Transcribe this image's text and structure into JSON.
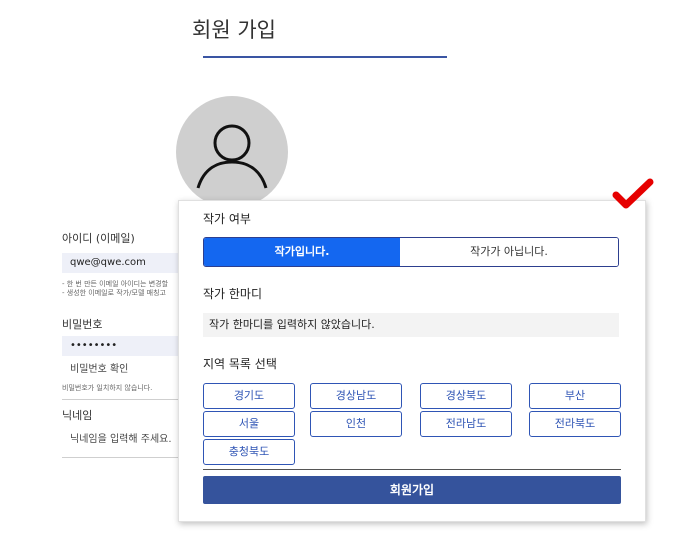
{
  "header": {
    "title": "회원 가입"
  },
  "form": {
    "id_label": "아이디 (이메일)",
    "id_value": "qwe@qwe.com",
    "id_hint_1": "- 한 번 만든 이메일 아이디는 변경할",
    "id_hint_2": "- 생성한 이메일로 작가/모델 매칭고",
    "password_label": "비밀번호",
    "password_value": "••••••••",
    "password_confirm_placeholder": "비밀번호 확인",
    "password_mismatch": "비밀번호가 일치하지 않습니다.",
    "nickname_label": "닉네임",
    "nickname_placeholder": "닉네임을 입력해 주세요."
  },
  "popup": {
    "author_label": "작가 여부",
    "author_yes": "작가입니다.",
    "author_no": "작가가 아닙니다.",
    "intro_label": "작가 한마디",
    "intro_message": "작가 한마디를 입력하지 않았습니다.",
    "region_label": "지역 목록 선택",
    "regions": [
      "경기도",
      "경상남도",
      "경상북도",
      "부산",
      "서울",
      "인천",
      "전라남도",
      "전라북도",
      "충청북도"
    ],
    "submit": "회원가입"
  },
  "colors": {
    "accent": "#1467f0",
    "primary": "#35539c",
    "check": "#e60000"
  },
  "icons": [
    "avatar-icon",
    "checkmark-icon"
  ]
}
